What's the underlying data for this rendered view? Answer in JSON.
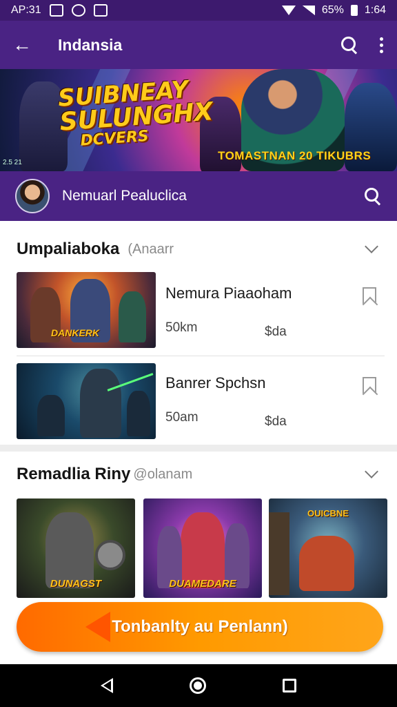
{
  "status_bar": {
    "time": "AP:31",
    "battery_text": "65%",
    "clock_right": "1:64"
  },
  "app_bar": {
    "title": "Indansia",
    "back_icon": "back-arrow-icon",
    "search_icon": "search-icon",
    "more_icon": "more-vert-icon"
  },
  "banner": {
    "title_line1": "SUIBNEAY",
    "title_line2": "SULUNGHX",
    "title_line3": "DCVERS",
    "subtitle": "TOMASTNAN 20 TIKUBRS",
    "corner_text": "2.5 21"
  },
  "profile": {
    "name": "Nemuarl Pealuclica",
    "search_icon": "search-icon"
  },
  "section1": {
    "title": "Umpaliaboka",
    "subtitle": "(Anaarr",
    "items": [
      {
        "title": "Nemura Piaaoham",
        "meta1": "50km",
        "meta2": "$da",
        "thumb_label": "DANKERK"
      },
      {
        "title": "Banrer Spchsn",
        "meta1": "50am",
        "meta2": "$da",
        "thumb_label": ""
      }
    ]
  },
  "section2": {
    "title": "Remadlia Riny",
    "subtitle": "@olanam",
    "cards": [
      {
        "label": "DUNAGST"
      },
      {
        "label": "DUAMEDARE"
      },
      {
        "label": "OUICBNE"
      }
    ]
  },
  "cta": {
    "label": "Tonbanlty au Penlann)"
  },
  "nav": {
    "back": "back-triangle-icon",
    "home": "home-circle-icon",
    "recents": "recents-square-icon"
  },
  "colors": {
    "app_bar": "#4a2384",
    "status_bar": "#3d1a6e",
    "cta": "#ff8a00"
  }
}
